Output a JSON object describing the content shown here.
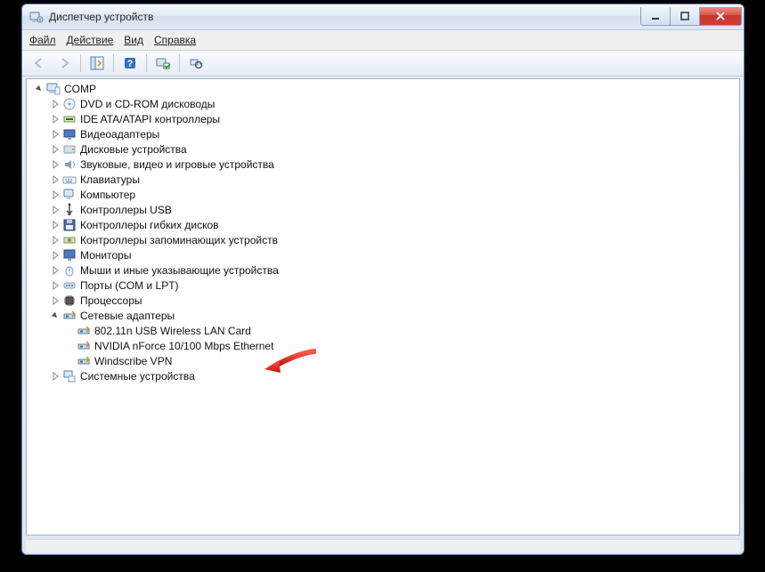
{
  "window": {
    "title": "Диспетчер устройств"
  },
  "menu": {
    "file": "Файл",
    "action": "Действие",
    "view": "Вид",
    "help": "Справка"
  },
  "tree": {
    "root": "COMP",
    "categories": [
      {
        "label": "DVD и CD-ROM дисководы",
        "icon": "disc"
      },
      {
        "label": "IDE ATA/ATAPI контроллеры",
        "icon": "ide"
      },
      {
        "label": "Видеоадаптеры",
        "icon": "display"
      },
      {
        "label": "Дисковые устройства",
        "icon": "disk"
      },
      {
        "label": "Звуковые, видео и игровые устройства",
        "icon": "sound"
      },
      {
        "label": "Клавиатуры",
        "icon": "keyboard"
      },
      {
        "label": "Компьютер",
        "icon": "computer"
      },
      {
        "label": "Контроллеры USB",
        "icon": "usb"
      },
      {
        "label": "Контроллеры гибких дисков",
        "icon": "floppy"
      },
      {
        "label": "Контроллеры запоминающих устройств",
        "icon": "storage"
      },
      {
        "label": "Мониторы",
        "icon": "monitor"
      },
      {
        "label": "Мыши и иные указывающие устройства",
        "icon": "mouse"
      },
      {
        "label": "Порты (COM и LPT)",
        "icon": "port"
      },
      {
        "label": "Процессоры",
        "icon": "cpu"
      },
      {
        "label": "Сетевые адаптеры",
        "icon": "network",
        "expanded": true,
        "children": [
          {
            "label": "802.11n USB Wireless LAN Card"
          },
          {
            "label": "NVIDIA nForce 10/100 Mbps Ethernet"
          },
          {
            "label": "Windscribe VPN"
          }
        ]
      },
      {
        "label": "Системные устройства",
        "icon": "system"
      }
    ]
  }
}
